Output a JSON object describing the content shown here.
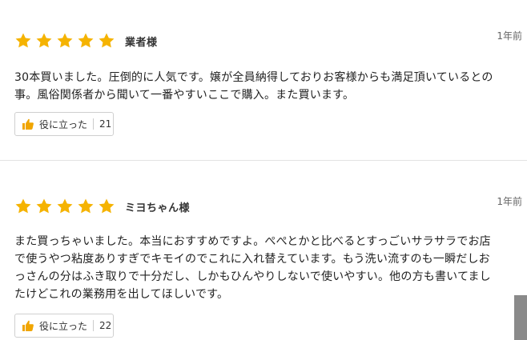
{
  "reviews": [
    {
      "rating": 5,
      "reviewer": "業者様",
      "time_ago": "1年前",
      "body": "30本買いました。圧倒的に人気です。嬢が全員納得しておりお客様からも満足頂いているとの\n事。風俗関係者から聞いて一番やすいここで購入。また買います。",
      "helpful_label": "役に立った",
      "helpful_count": "21"
    },
    {
      "rating": 5,
      "reviewer": "ミヨちゃん様",
      "time_ago": "1年前",
      "body": "また買っちゃいました。本当におすすめですよ。ぺぺとかと比べるとすっごいサラサラでお店\nで使うやつ粘度ありすぎでキモイのでこれに入れ替えています。もう洗い流すのも一瞬だしお\nっさんの分はふき取りで十分だし、しかもひんやりしないで使いやすい。他の方も書いてまし\nたけどこれの業務用を出してほしいです。",
      "helpful_label": "役に立った",
      "helpful_count": "22"
    }
  ],
  "colors": {
    "star": "#f5b301",
    "thumb": "#f0a500",
    "divider": "#e3e3e3",
    "scrollbar": "#8a8a8a"
  },
  "icons": {
    "star": "star-icon",
    "thumb": "thumbs-up-icon"
  }
}
